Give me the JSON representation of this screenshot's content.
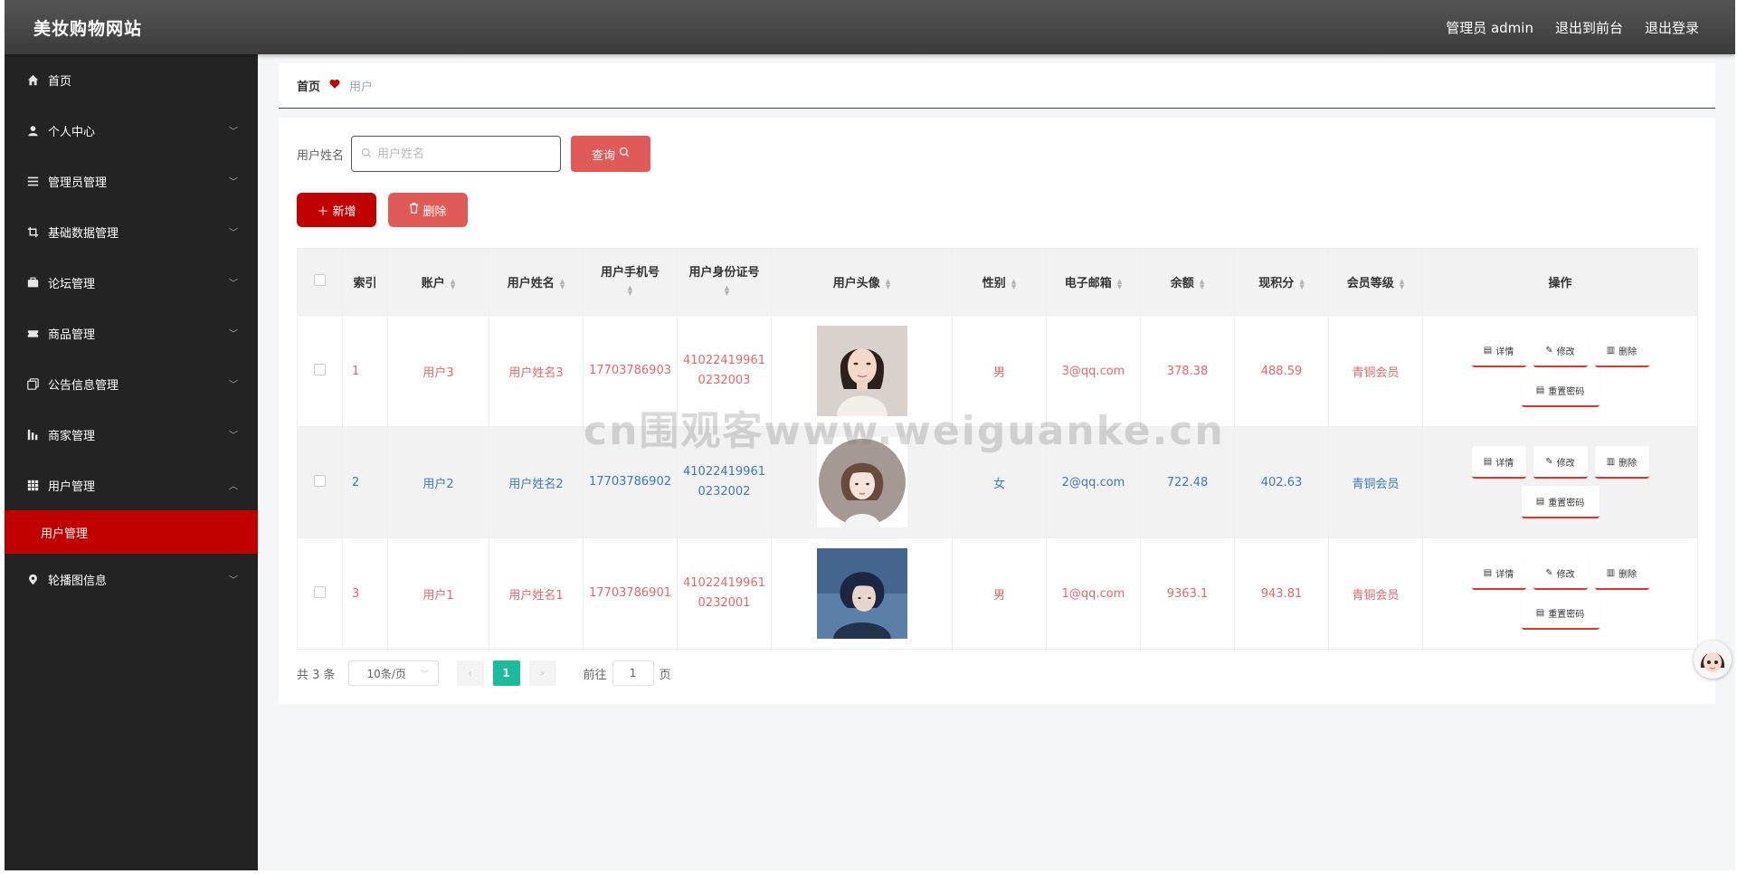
{
  "header": {
    "brand": "美妆购物网站",
    "admin_label": "管理员 admin",
    "front_link": "退出到前台",
    "logout_link": "退出登录"
  },
  "sidebar": {
    "items": [
      {
        "label": "首页",
        "icon": "home-icon"
      },
      {
        "label": "个人中心",
        "icon": "user-icon"
      },
      {
        "label": "管理员管理",
        "icon": "list-icon"
      },
      {
        "label": "基础数据管理",
        "icon": "crop-icon"
      },
      {
        "label": "论坛管理",
        "icon": "suitcase-icon"
      },
      {
        "label": "商品管理",
        "icon": "ticket-icon"
      },
      {
        "label": "公告信息管理",
        "icon": "copy-icon"
      },
      {
        "label": "商家管理",
        "icon": "chart-icon"
      },
      {
        "label": "用户管理",
        "icon": "grid-icon"
      },
      {
        "label": "轮播图信息",
        "icon": "location-icon"
      }
    ],
    "active_sub": "用户管理"
  },
  "breadcrumb": {
    "home": "首页",
    "current": "用户"
  },
  "search": {
    "label": "用户姓名",
    "placeholder": "用户姓名",
    "button": "查询"
  },
  "actions": {
    "add": "新增",
    "delete": "删除"
  },
  "table": {
    "headers": [
      "索引",
      "账户",
      "用户姓名",
      "用户手机号",
      "用户身份证号",
      "用户头像",
      "性别",
      "电子邮箱",
      "余额",
      "现积分",
      "会员等级",
      "操作"
    ],
    "rows": [
      {
        "index": "1",
        "account": "用户3",
        "name": "用户姓名3",
        "phone": "17703786903",
        "idcard": "410224199610232003",
        "avatar": "avatar-woman-photo",
        "gender": "男",
        "email": "3@qq.com",
        "balance": "378.38",
        "points": "488.59",
        "level": "青铜会员"
      },
      {
        "index": "2",
        "account": "用户2",
        "name": "用户姓名2",
        "phone": "17703786902",
        "idcard": "410224199610232002",
        "avatar": "avatar-girl-illustration",
        "gender": "女",
        "email": "2@qq.com",
        "balance": "722.48",
        "points": "402.63",
        "level": "青铜会员"
      },
      {
        "index": "3",
        "account": "用户1",
        "name": "用户姓名1",
        "phone": "17703786901",
        "idcard": "410224199610232001",
        "avatar": "avatar-boy-illustration",
        "gender": "男",
        "email": "1@qq.com",
        "balance": "9363.1",
        "points": "943.81",
        "level": "青铜会员"
      }
    ],
    "ops": {
      "detail": "详情",
      "edit": "修改",
      "delete": "删除",
      "reset": "重置密码"
    }
  },
  "pagination": {
    "total": "共 3 条",
    "page_size": "10条/页",
    "current": "1",
    "goto_prefix": "前往",
    "goto_value": "1",
    "goto_suffix": "页"
  },
  "watermark": "cn围观客www.weiguanke.cn",
  "colors": {
    "primary": "#c10000",
    "secondary": "#e05a57",
    "odd_row_text": "#e8666a",
    "even_row_text": "#3d79bd",
    "page_active": "#1abc9c"
  }
}
